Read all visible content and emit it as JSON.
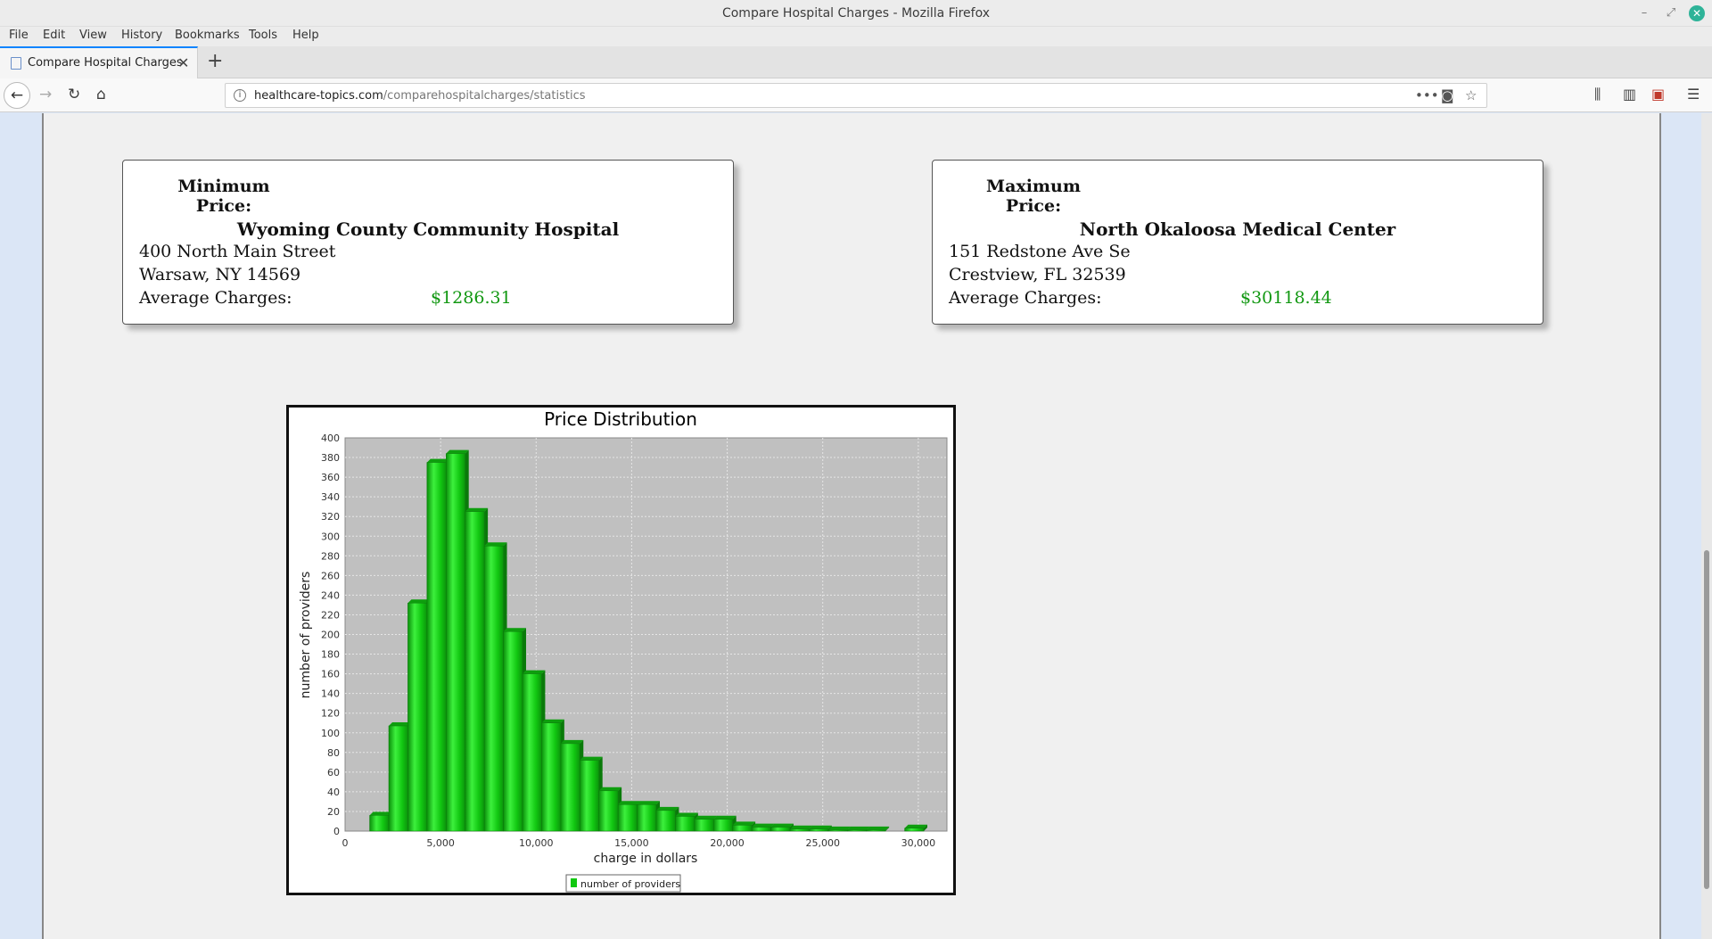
{
  "window": {
    "title": "Compare Hospital Charges - Mozilla Firefox"
  },
  "menu": [
    "File",
    "Edit",
    "View",
    "History",
    "Bookmarks",
    "Tools",
    "Help"
  ],
  "tab": {
    "label": "Compare Hospital Charges"
  },
  "url": {
    "domain": "healthcare-topics.com",
    "path": "/comparehospitalcharges/statistics"
  },
  "min_card": {
    "label": "Minimum Price:",
    "hospital": "Wyoming County Community Hospital",
    "street": "400 North Main Street",
    "city_line": "Warsaw,  NY  14569",
    "avg_label": "Average Charges:",
    "avg_value": "$1286.31"
  },
  "max_card": {
    "label": "Maximum Price:",
    "hospital": "North Okaloosa Medical Center",
    "street": "151 Redstone Ave Se",
    "city_line": "Crestview,  FL  32539",
    "avg_label": "Average Charges:",
    "avg_value": "$30118.44"
  },
  "colors": {
    "bar": "#11c811",
    "plot_bg": "#c0c0c0",
    "price": "#129812"
  },
  "chart_data": {
    "type": "bar",
    "title": "Price Distribution",
    "xlabel": "charge in dollars",
    "ylabel": "number of providers",
    "legend": "number of providers",
    "legend_position": "bottom",
    "grid": true,
    "xlim": [
      0,
      31500
    ],
    "ylim": [
      0,
      400
    ],
    "xticks": [
      "0",
      "5,000",
      "10,000",
      "15,000",
      "20,000",
      "25,000",
      "30,000"
    ],
    "yticks": [
      "0",
      "20",
      "40",
      "60",
      "80",
      "100",
      "120",
      "140",
      "160",
      "180",
      "200",
      "220",
      "240",
      "260",
      "280",
      "300",
      "320",
      "340",
      "360",
      "380",
      "400"
    ],
    "bin_width": 1000,
    "bins": [
      {
        "x0": 1286,
        "value": 16
      },
      {
        "x0": 2286,
        "value": 107
      },
      {
        "x0": 3286,
        "value": 232
      },
      {
        "x0": 4286,
        "value": 375
      },
      {
        "x0": 5286,
        "value": 384
      },
      {
        "x0": 6286,
        "value": 325
      },
      {
        "x0": 7286,
        "value": 290
      },
      {
        "x0": 8286,
        "value": 203
      },
      {
        "x0": 9286,
        "value": 160
      },
      {
        "x0": 10286,
        "value": 110
      },
      {
        "x0": 11286,
        "value": 89
      },
      {
        "x0": 12286,
        "value": 72
      },
      {
        "x0": 13286,
        "value": 41
      },
      {
        "x0": 14286,
        "value": 27
      },
      {
        "x0": 15286,
        "value": 27
      },
      {
        "x0": 16286,
        "value": 21
      },
      {
        "x0": 17286,
        "value": 15
      },
      {
        "x0": 18286,
        "value": 12
      },
      {
        "x0": 19286,
        "value": 12
      },
      {
        "x0": 20286,
        "value": 6
      },
      {
        "x0": 21286,
        "value": 4
      },
      {
        "x0": 22286,
        "value": 4
      },
      {
        "x0": 23286,
        "value": 2
      },
      {
        "x0": 24286,
        "value": 2
      },
      {
        "x0": 25286,
        "value": 1
      },
      {
        "x0": 26286,
        "value": 1
      },
      {
        "x0": 27286,
        "value": 1
      },
      {
        "x0": 29286,
        "value": 3
      }
    ]
  }
}
